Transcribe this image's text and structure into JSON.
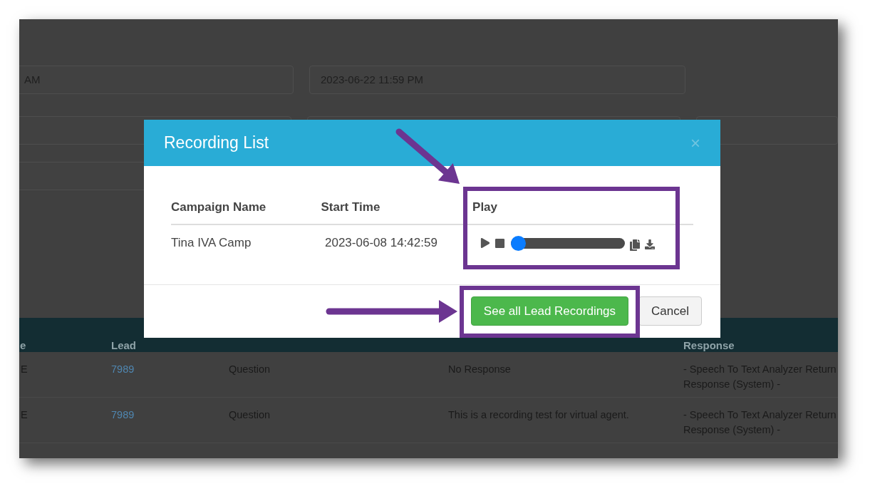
{
  "background_page": {
    "date_fields": [
      {
        "value": "AM"
      },
      {
        "value": "2023-06-22 11:59 PM"
      }
    ],
    "table": {
      "header_cells": [
        "e",
        "Lead",
        "Response"
      ],
      "rows": [
        {
          "column_1": "E",
          "lead": "7989",
          "question": "Question",
          "answer": "No Response",
          "response": "- Speech To Text Analyzer Return Response (System) -"
        },
        {
          "column_1": "E",
          "lead": "7989",
          "question": "Question",
          "answer": "This is a recording test for virtual agent.",
          "response": "- Speech To Text Analyzer Return Response (System) -"
        }
      ]
    }
  },
  "dialog": {
    "title": "Recording List",
    "close": "×",
    "columns": [
      "Campaign Name",
      "Start Time",
      "Play"
    ],
    "rows": [
      {
        "campaign_name": "Tina IVA Camp",
        "start_time": "2023-06-08 14:42:59",
        "player": {
          "level": 0
        }
      }
    ],
    "buttons": [
      {
        "label": "See all Lead Recordings",
        "kind": "primary"
      },
      {
        "label": "Cancel",
        "kind": "secondary"
      }
    ]
  }
}
